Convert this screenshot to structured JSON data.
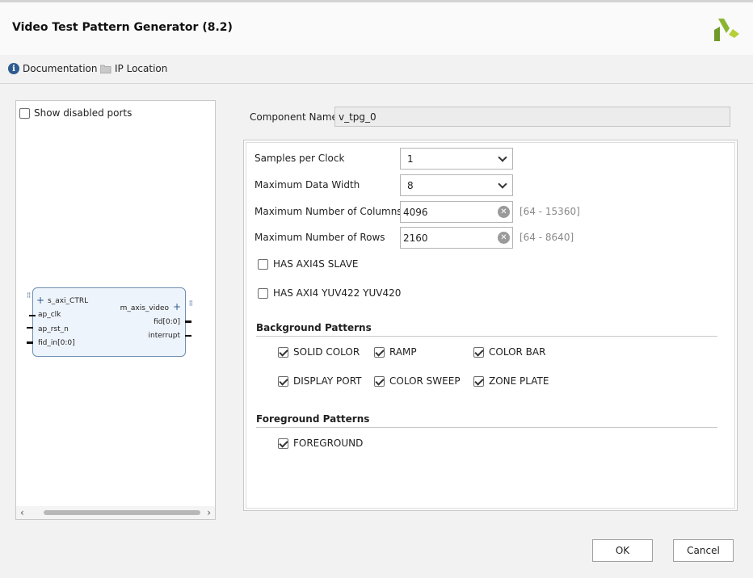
{
  "window": {
    "title": "Video Test Pattern Generator (8.2)"
  },
  "links": {
    "documentation": "Documentation",
    "ip_location": "IP Location"
  },
  "left_panel": {
    "show_disabled_ports": "Show disabled ports",
    "block": {
      "s_axi": "s_axi_CTRL",
      "ap_clk": "ap_clk",
      "ap_rst_n": "ap_rst_n",
      "fid_in": "fid_in[0:0]",
      "m_axis": "m_axis_video",
      "fid": "fid[0:0]",
      "interrupt": "interrupt"
    }
  },
  "component": {
    "label": "Component Name",
    "value": "v_tpg_0"
  },
  "params": {
    "samples_label": "Samples per Clock",
    "samples_value": "1",
    "width_label": "Maximum Data Width",
    "width_value": "8",
    "cols_label": "Maximum Number of Columns",
    "cols_value": "4096",
    "cols_range": "[64 - 15360]",
    "rows_label": "Maximum Number of Rows",
    "rows_value": "2160",
    "rows_range": "[64 - 8640]",
    "axi4s_slave": "HAS AXI4S SLAVE",
    "yuv": "HAS AXI4 YUV422 YUV420"
  },
  "background": {
    "title": "Background Patterns",
    "solid_color": "SOLID COLOR",
    "ramp": "RAMP",
    "color_bar": "COLOR BAR",
    "display_port": "DISPLAY PORT",
    "color_sweep": "COLOR SWEEP",
    "zone_plate": "ZONE PLATE"
  },
  "foreground": {
    "title": "Foreground Patterns",
    "foreground": "FOREGROUND"
  },
  "buttons": {
    "ok": "OK",
    "cancel": "Cancel"
  },
  "colors": {
    "accent": "#2d5b8f",
    "logo_green": "#8bb531"
  }
}
